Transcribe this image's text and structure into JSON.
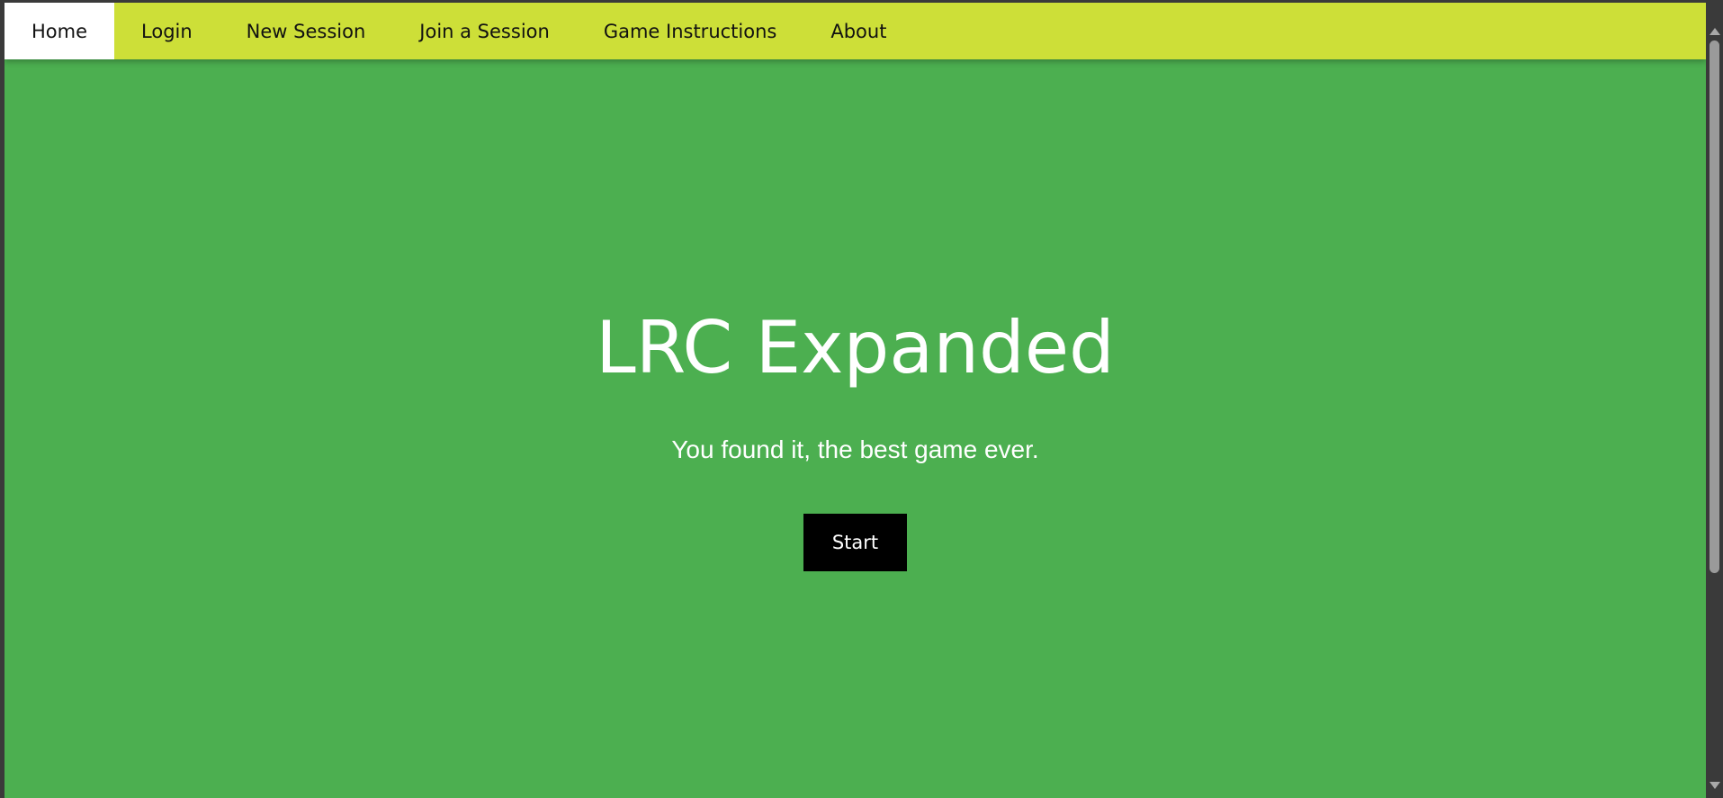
{
  "nav": {
    "items": [
      {
        "label": "Home",
        "active": true
      },
      {
        "label": "Login",
        "active": false
      },
      {
        "label": "New Session",
        "active": false
      },
      {
        "label": "Join a Session",
        "active": false
      },
      {
        "label": "Game Instructions",
        "active": false
      },
      {
        "label": "About",
        "active": false
      }
    ]
  },
  "hero": {
    "title": "LRC Expanded",
    "subtitle": "You found it, the best game ever.",
    "start_label": "Start"
  },
  "colors": {
    "navbar": "#cddf38",
    "background": "#4caf50",
    "active_tab": "#ffffff",
    "button": "#000000"
  }
}
